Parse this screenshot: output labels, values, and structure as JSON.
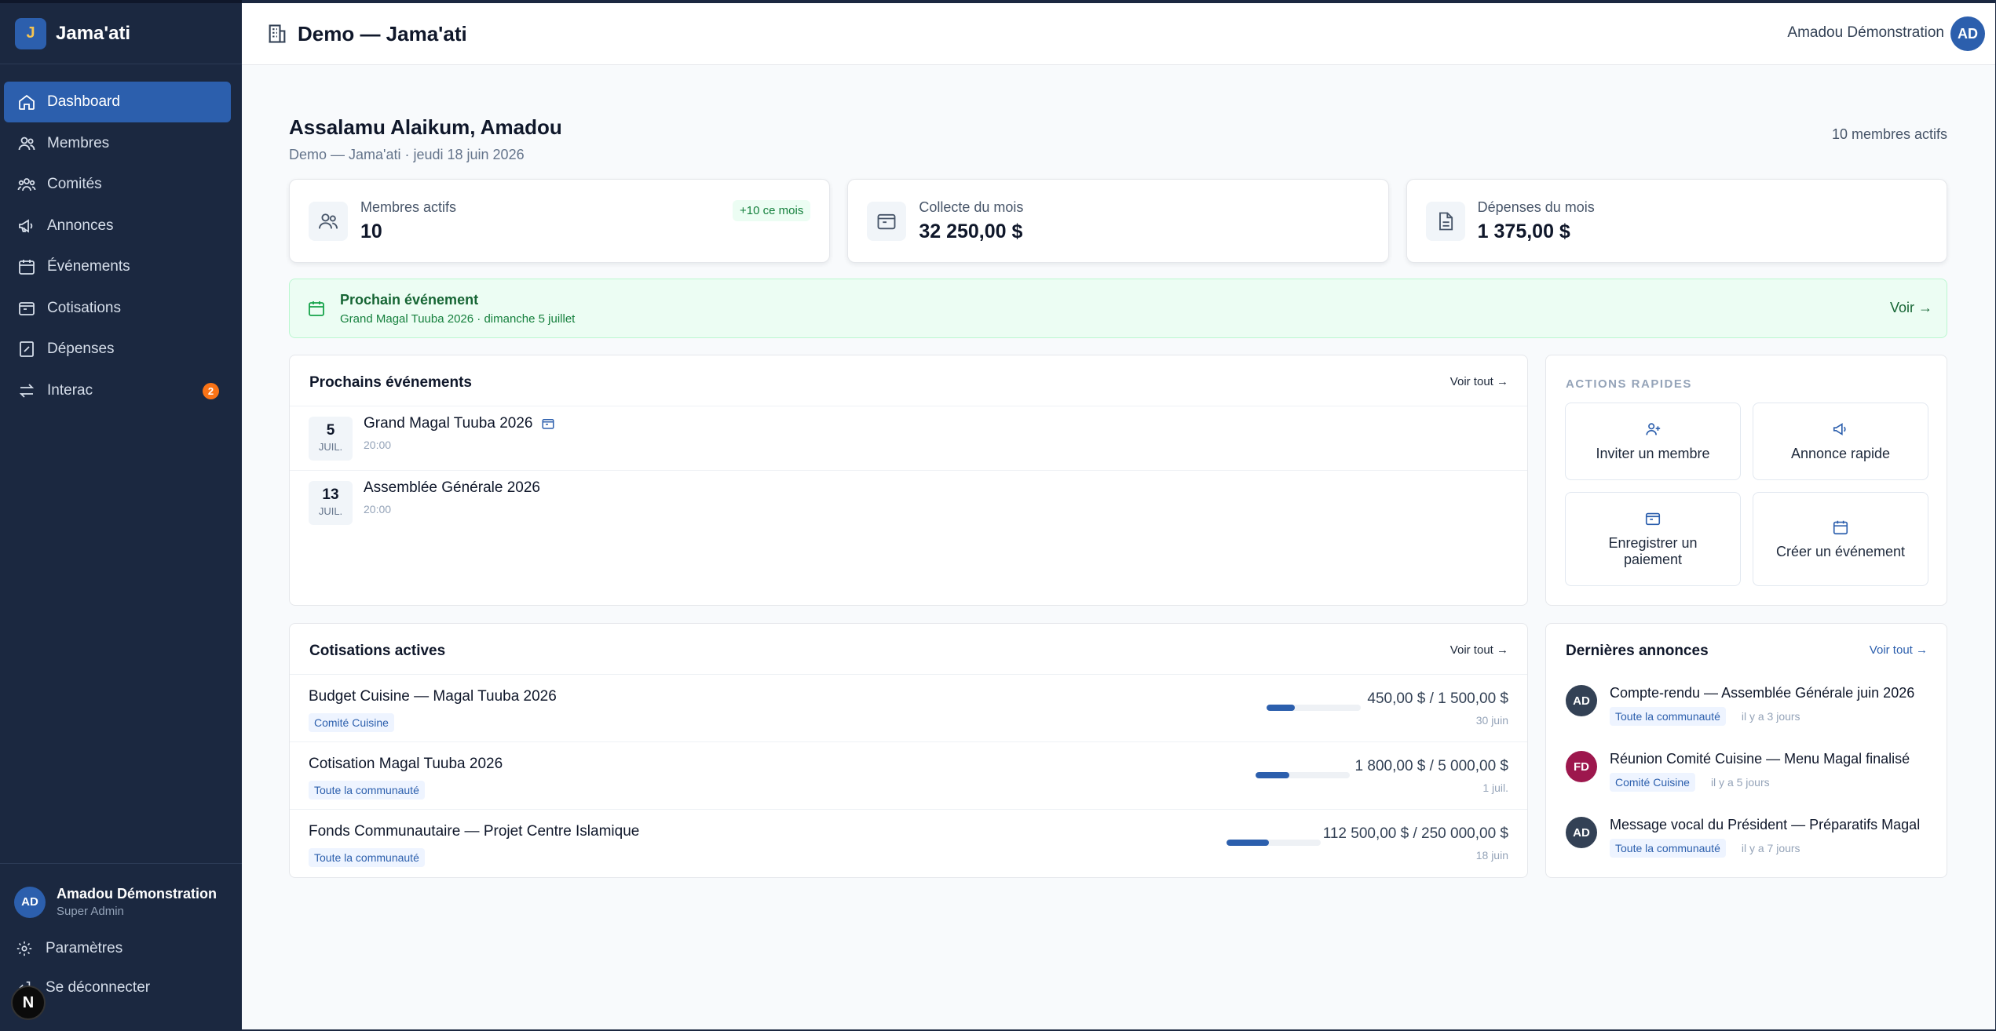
{
  "brand": {
    "initial": "J",
    "name": "Jama'ati"
  },
  "sidebar": {
    "items": [
      {
        "label": "Dashboard"
      },
      {
        "label": "Membres"
      },
      {
        "label": "Comités"
      },
      {
        "label": "Annonces"
      },
      {
        "label": "Événements"
      },
      {
        "label": "Cotisations"
      },
      {
        "label": "Dépenses"
      },
      {
        "label": "Interac",
        "badge": "2"
      }
    ],
    "user": {
      "initials": "AD",
      "name": "Amadou Démonstration",
      "role": "Super Admin"
    },
    "settings_label": "Paramètres",
    "logout_label": "Se déconnecter",
    "n_badge": "N"
  },
  "topbar": {
    "title": "Demo — Jama'ati",
    "user_name": "Amadou Démonstration",
    "user_initials": "AD"
  },
  "header": {
    "greeting": "Assalamu Alaikum, Amadou",
    "subtitle": "Demo — Jama'ati · jeudi 18 juin 2026",
    "members_count": "10 membres actifs"
  },
  "stats": [
    {
      "label": "Membres actifs",
      "value": "10",
      "pill": "+10 ce mois"
    },
    {
      "label": "Collecte du mois",
      "value": "32 250,00 $"
    },
    {
      "label": "Dépenses du mois",
      "value": "1 375,00 $"
    }
  ],
  "next_event": {
    "title": "Prochain événement",
    "subtitle": "Grand Magal Tuuba 2026 · dimanche 5 juillet",
    "link": "Voir →"
  },
  "events": {
    "title": "Prochains événements",
    "link": "Voir tout →",
    "items": [
      {
        "day": "5",
        "month": "JUIL.",
        "name": "Grand Magal Tuuba 2026",
        "time": "20:00"
      },
      {
        "day": "13",
        "month": "JUIL.",
        "name": "Assemblée Générale 2026",
        "time": "20:00"
      }
    ]
  },
  "quick_actions": {
    "title": "ACTIONS RAPIDES",
    "items": [
      {
        "label": "Inviter un membre",
        "icon": "user-plus-icon"
      },
      {
        "label": "Annonce rapide",
        "icon": "megaphone-icon"
      },
      {
        "label": "Enregistrer un paiement",
        "icon": "wallet-icon"
      },
      {
        "label": "Créer un événement",
        "icon": "calendar-icon"
      }
    ]
  },
  "contributions": {
    "title": "Cotisations actives",
    "link": "Voir tout →",
    "items": [
      {
        "name": "Budget Cuisine — Magal Tuuba 2026",
        "tag": "Comité Cuisine",
        "amount": "450,00 $ / 1 500,00 $",
        "date": "30 juin",
        "progress": 0.3
      },
      {
        "name": "Cotisation Magal Tuuba 2026",
        "tag": "Toute la communauté",
        "amount": "1 800,00 $ / 5 000,00 $",
        "date": "1 juil.",
        "progress": 0.36
      },
      {
        "name": "Fonds Communautaire — Projet Centre Islamique",
        "tag": "Toute la communauté",
        "amount": "112 500,00 $ / 250 000,00 $",
        "date": "18 juin",
        "progress": 0.45
      }
    ]
  },
  "announcements": {
    "title": "Dernières annonces",
    "link": "Voir tout →",
    "items": [
      {
        "initials": "AD",
        "title": "Compte-rendu — Assemblée Générale juin 2026",
        "tag": "Toute la communauté",
        "when": "il y a 3 jours"
      },
      {
        "initials": "FD",
        "title": "Réunion Comité Cuisine — Menu Magal finalisé",
        "tag": "Comité Cuisine",
        "when": "il y a 5 jours"
      },
      {
        "initials": "AD",
        "title": "Message vocal du Président — Préparatifs Magal",
        "tag": "Toute la communauté",
        "when": "il y a 7 jours"
      }
    ]
  },
  "colors": {
    "primary": "#2c5fad",
    "sidebar": "#1b2840",
    "success": "#16a34a",
    "badge": "#f97316"
  }
}
